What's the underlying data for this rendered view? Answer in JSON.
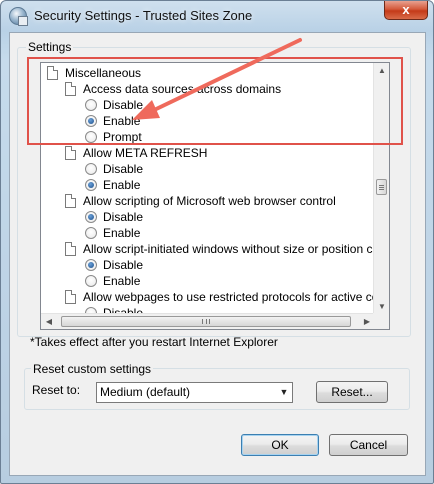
{
  "window": {
    "title": "Security Settings - Trusted Sites Zone",
    "close_label": "x"
  },
  "settings": {
    "group_label": "Settings",
    "rows": [
      {
        "kind": "doc",
        "text": "Miscellaneous",
        "checked": false
      },
      {
        "kind": "doc",
        "text": "Access data sources across domains",
        "checked": false
      },
      {
        "kind": "radio",
        "text": "Disable",
        "checked": false
      },
      {
        "kind": "radio",
        "text": "Enable",
        "checked": true
      },
      {
        "kind": "radio",
        "text": "Prompt",
        "checked": false
      },
      {
        "kind": "doc",
        "text": "Allow META REFRESH",
        "checked": false
      },
      {
        "kind": "radio",
        "text": "Disable",
        "checked": false
      },
      {
        "kind": "radio",
        "text": "Enable",
        "checked": true
      },
      {
        "kind": "doc",
        "text": "Allow scripting of Microsoft web browser control",
        "checked": false
      },
      {
        "kind": "radio",
        "text": "Disable",
        "checked": true
      },
      {
        "kind": "radio",
        "text": "Enable",
        "checked": false
      },
      {
        "kind": "doc",
        "text": "Allow script-initiated windows without size or position constra",
        "checked": false
      },
      {
        "kind": "radio",
        "text": "Disable",
        "checked": true
      },
      {
        "kind": "radio",
        "text": "Enable",
        "checked": false
      },
      {
        "kind": "doc",
        "text": "Allow webpages to use restricted protocols for active conten",
        "checked": false
      },
      {
        "kind": "radio",
        "text": "Disable",
        "checked": false
      }
    ]
  },
  "note": "*Takes effect after you restart Internet Explorer",
  "reset": {
    "group_label": "Reset custom settings",
    "reset_to_label": "Reset to:",
    "selected_level": "Medium (default)",
    "reset_button": "Reset..."
  },
  "buttons": {
    "ok": "OK",
    "cancel": "Cancel"
  },
  "colors": {
    "highlight": "#e0524a",
    "arrow": "#ef6a5c"
  }
}
